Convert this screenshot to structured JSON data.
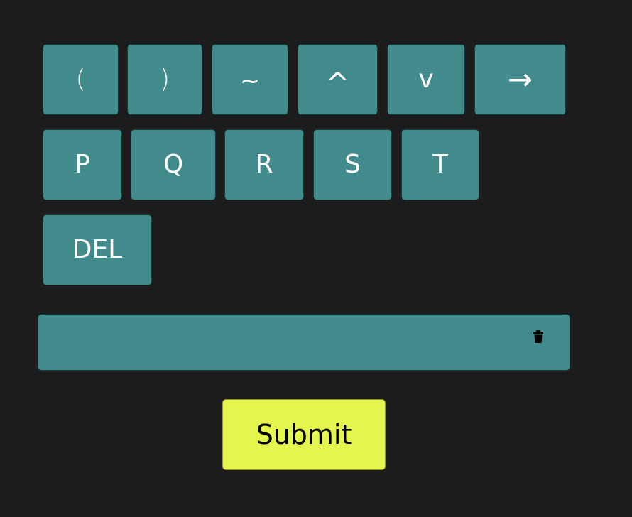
{
  "keypad": {
    "row1": [
      "(",
      ")",
      "~",
      "^",
      "v",
      "→"
    ],
    "row2": [
      "P",
      "Q",
      "R",
      "S",
      "T"
    ],
    "row3": [
      "DEL"
    ]
  },
  "input": {
    "value": "",
    "clear_icon": "trash-icon"
  },
  "submit": {
    "label": "Submit"
  },
  "colors": {
    "background": "#1c1c1c",
    "key": "#418b8d",
    "submit": "#e4f54e",
    "key_text": "#ffffff"
  }
}
